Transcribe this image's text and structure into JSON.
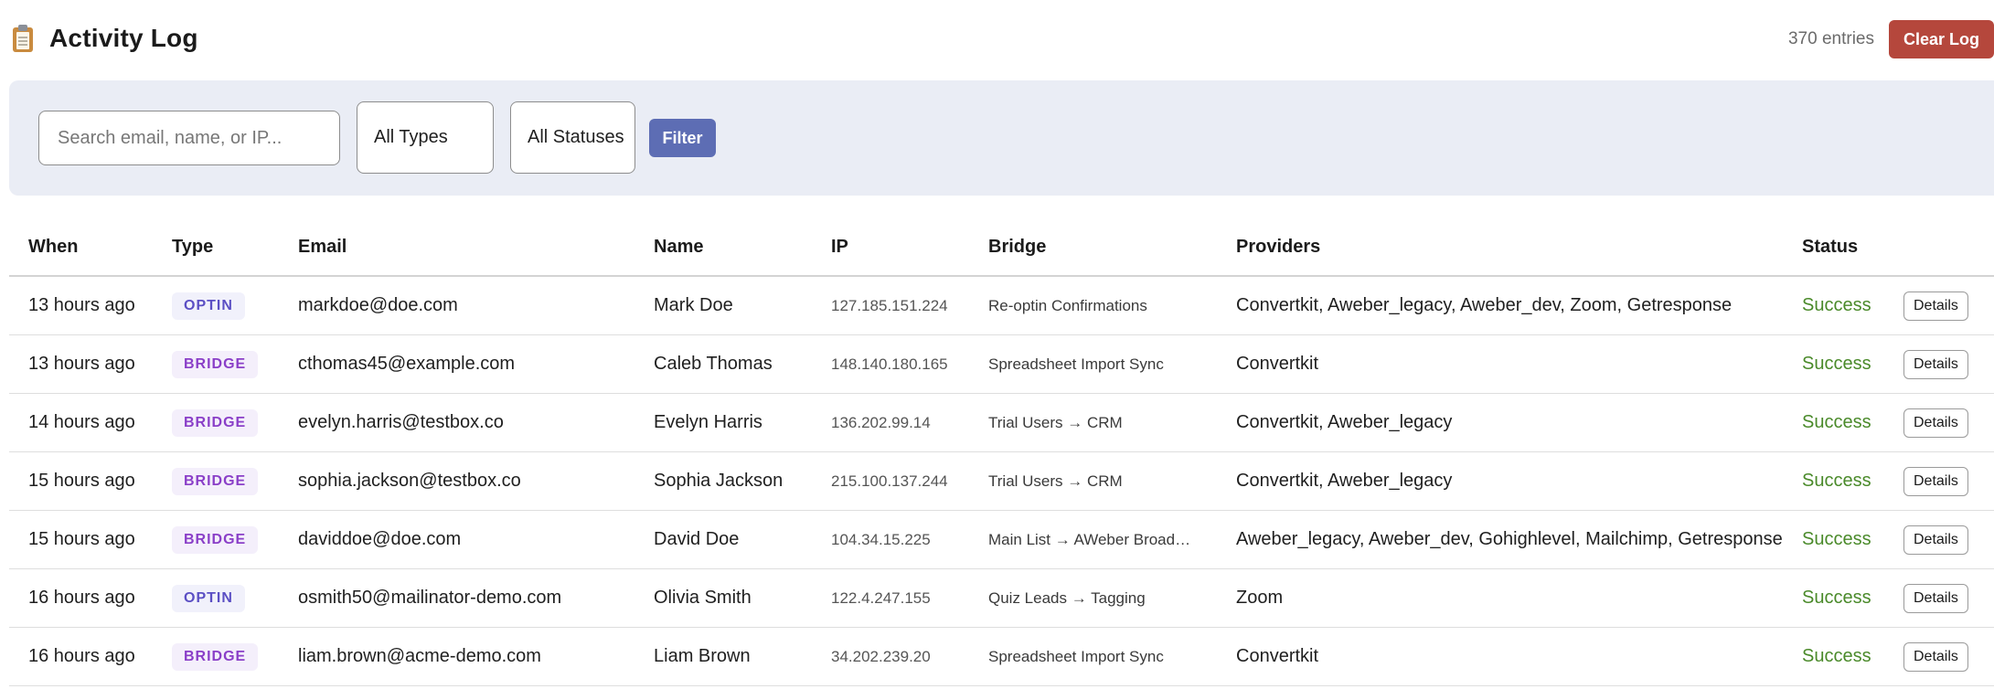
{
  "header": {
    "title": "Activity Log",
    "title_icon": "clipboard-icon",
    "entry_count": "370 entries",
    "clear_label": "Clear Log"
  },
  "filters": {
    "search_placeholder": "Search email, name, or IP...",
    "type_select": "All Types",
    "status_select": "All Statuses",
    "filter_label": "Filter"
  },
  "colors": {
    "clear_button": "#b5473c",
    "filter_button": "#5d6db4",
    "success": "#4a8a2a",
    "optin_badge": "#5b4fc4",
    "bridge_badge": "#8a3fc8",
    "filter_bar_bg": "#eaedf5"
  },
  "table": {
    "columns": [
      "When",
      "Type",
      "Email",
      "Name",
      "IP",
      "Bridge",
      "Providers",
      "Status",
      ""
    ],
    "rows": [
      {
        "when": "13 hours ago",
        "type": "OPTIN",
        "email": "markdoe@doe.com",
        "name": "Mark Doe",
        "ip": "127.185.151.224",
        "bridge": "Re-optin Confirmations",
        "providers": "Convertkit, Aweber_legacy, Aweber_dev, Zoom, Getresponse",
        "status": "Success",
        "action": "Details"
      },
      {
        "when": "13 hours ago",
        "type": "BRIDGE",
        "email": "cthomas45@example.com",
        "name": "Caleb Thomas",
        "ip": "148.140.180.165",
        "bridge": "Spreadsheet Import Sync",
        "providers": "Convertkit",
        "status": "Success",
        "action": "Details"
      },
      {
        "when": "14 hours ago",
        "type": "BRIDGE",
        "email": "evelyn.harris@testbox.co",
        "name": "Evelyn Harris",
        "ip": "136.202.99.14",
        "bridge": "Trial Users → CRM",
        "providers": "Convertkit, Aweber_legacy",
        "status": "Success",
        "action": "Details"
      },
      {
        "when": "15 hours ago",
        "type": "BRIDGE",
        "email": "sophia.jackson@testbox.co",
        "name": "Sophia Jackson",
        "ip": "215.100.137.244",
        "bridge": "Trial Users → CRM",
        "providers": "Convertkit, Aweber_legacy",
        "status": "Success",
        "action": "Details"
      },
      {
        "when": "15 hours ago",
        "type": "BRIDGE",
        "email": "daviddoe@doe.com",
        "name": "David Doe",
        "ip": "104.34.15.225",
        "bridge": "Main List → AWeber Broad…",
        "providers": "Aweber_legacy, Aweber_dev, Gohighlevel, Mailchimp, Getresponse",
        "status": "Success",
        "action": "Details"
      },
      {
        "when": "16 hours ago",
        "type": "OPTIN",
        "email": "osmith50@mailinator-demo.com",
        "name": "Olivia Smith",
        "ip": "122.4.247.155",
        "bridge": "Quiz Leads → Tagging",
        "providers": "Zoom",
        "status": "Success",
        "action": "Details"
      },
      {
        "when": "16 hours ago",
        "type": "BRIDGE",
        "email": "liam.brown@acme-demo.com",
        "name": "Liam Brown",
        "ip": "34.202.239.20",
        "bridge": "Spreadsheet Import Sync",
        "providers": "Convertkit",
        "status": "Success",
        "action": "Details"
      }
    ]
  }
}
